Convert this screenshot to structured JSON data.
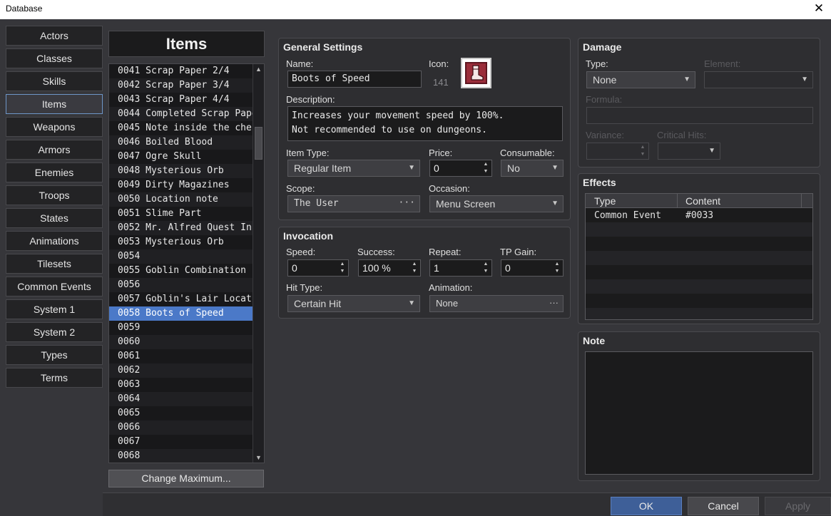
{
  "window": {
    "title": "Database",
    "close_glyph": "✕"
  },
  "tabs": [
    "Actors",
    "Classes",
    "Skills",
    "Items",
    "Weapons",
    "Armors",
    "Enemies",
    "Troops",
    "States",
    "Animations",
    "Tilesets",
    "Common Events",
    "System 1",
    "System 2",
    "Types",
    "Terms"
  ],
  "selected_tab": "Items",
  "list": {
    "title": "Items",
    "rows": [
      "0041 Scrap Paper 2/4",
      "0042 Scrap Paper 3/4",
      "0043 Scrap Paper 4/4",
      "0044 Completed Scrap Paper",
      "0045 Note inside the chest",
      "0046 Boiled Blood",
      "0047 Ogre Skull",
      "0048 Mysterious Orb",
      "0049 Dirty Magazines",
      "0050 Location note",
      "0051 Slime Part",
      "0052 Mr. Alfred Quest In···",
      "0053 Mysterious Orb",
      "0054",
      "0055 Goblin Combination ···",
      "0056",
      "0057 Goblin's Lair Locat···",
      "0058 Boots of Speed",
      "0059",
      "0060",
      "0061",
      "0062",
      "0063",
      "0064",
      "0065",
      "0066",
      "0067",
      "0068"
    ],
    "selected_row": "0058 Boots of Speed",
    "change_max_label": "Change Maximum..."
  },
  "general": {
    "title": "General Settings",
    "name_label": "Name:",
    "name_value": "Boots of Speed",
    "icon_label": "Icon:",
    "icon_index": "141",
    "icon_name": "boot-icon",
    "desc_label": "Description:",
    "desc_line1": "Increases your movement speed by 100%.",
    "desc_line2": "Not recommended to use on dungeons.",
    "item_type_label": "Item Type:",
    "item_type_value": "Regular Item",
    "price_label": "Price:",
    "price_value": "0",
    "consumable_label": "Consumable:",
    "consumable_value": "No",
    "scope_label": "Scope:",
    "scope_value": "The User",
    "occasion_label": "Occasion:",
    "occasion_value": "Menu Screen"
  },
  "invocation": {
    "title": "Invocation",
    "speed_label": "Speed:",
    "speed_value": "0",
    "success_label": "Success:",
    "success_value": "100 %",
    "repeat_label": "Repeat:",
    "repeat_value": "1",
    "tp_label": "TP Gain:",
    "tp_value": "0",
    "hit_type_label": "Hit Type:",
    "hit_type_value": "Certain Hit",
    "animation_label": "Animation:",
    "animation_value": "None"
  },
  "damage": {
    "title": "Damage",
    "type_label": "Type:",
    "type_value": "None",
    "element_label": "Element:",
    "formula_label": "Formula:",
    "variance_label": "Variance:",
    "critical_label": "Critical Hits:"
  },
  "effects": {
    "title": "Effects",
    "col_type": "Type",
    "col_content": "Content",
    "rows": [
      {
        "type": "Common Event",
        "content": "#0033"
      }
    ]
  },
  "note": {
    "title": "Note"
  },
  "buttons": {
    "ok": "OK",
    "cancel": "Cancel",
    "apply": "Apply"
  },
  "glyphs": {
    "dropdown": "▼",
    "spin_up": "▲",
    "spin_down": "▼",
    "ellipsis": "···"
  },
  "colors": {
    "selection": "#4b79c8",
    "panel": "#2e2e31",
    "field": "#1b1b1c"
  }
}
